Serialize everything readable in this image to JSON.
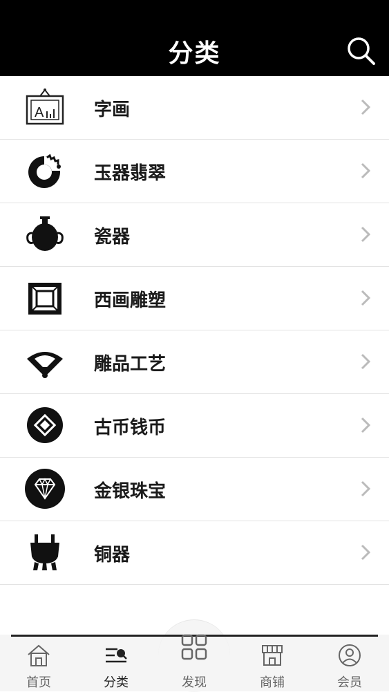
{
  "header": {
    "title": "分类"
  },
  "categories": [
    {
      "label": "字画",
      "icon": "painting-frame-icon"
    },
    {
      "label": "玉器翡翠",
      "icon": "jade-ring-icon"
    },
    {
      "label": "瓷器",
      "icon": "vase-icon"
    },
    {
      "label": "西画雕塑",
      "icon": "frame-icon"
    },
    {
      "label": "雕品工艺",
      "icon": "folding-fan-icon"
    },
    {
      "label": "古币钱币",
      "icon": "ancient-coin-icon"
    },
    {
      "label": "金银珠宝",
      "icon": "diamond-icon"
    },
    {
      "label": "铜器",
      "icon": "bronze-ding-icon"
    }
  ],
  "tabbar": {
    "items": [
      {
        "label": "首页",
        "icon": "home-icon"
      },
      {
        "label": "分类",
        "icon": "category-list-icon",
        "active": true
      },
      {
        "label": "发现",
        "icon": "grid-icon"
      },
      {
        "label": "商铺",
        "icon": "store-icon"
      },
      {
        "label": "会员",
        "icon": "user-icon"
      }
    ]
  },
  "colors": {
    "header_bg": "#000000",
    "tabbar_bg": "#f5f5f5",
    "chevron": "#bbbbbb"
  }
}
